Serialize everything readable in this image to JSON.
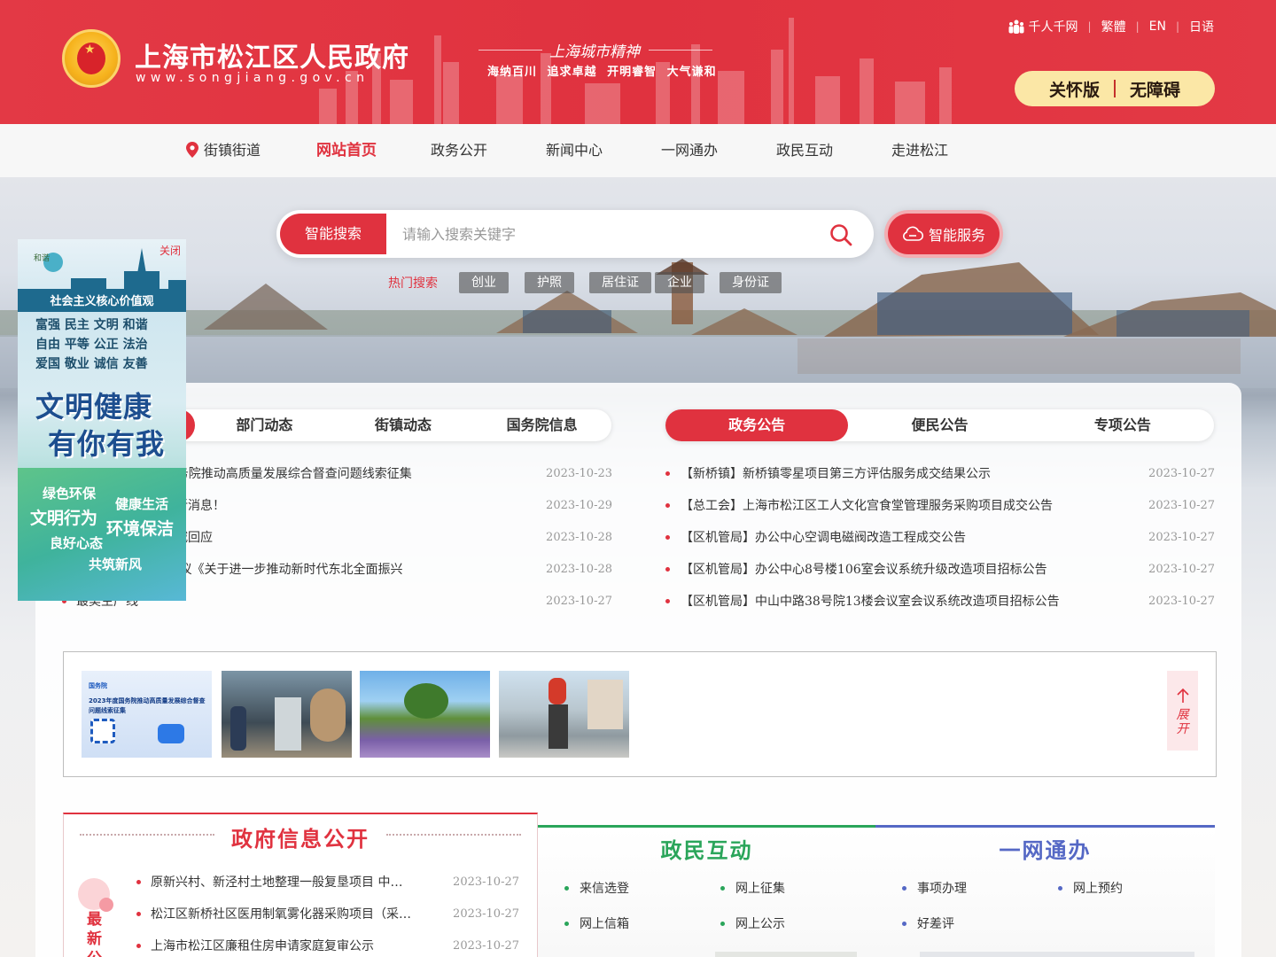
{
  "header": {
    "site_title": "上海市松江区人民政府",
    "site_url": "www.songjiang.gov.cn",
    "spirit_title": "上海城市精神",
    "spirit_words": [
      "海纳百川",
      "追求卓越",
      "开明睿智",
      "大气谦和"
    ],
    "top_links": [
      "千人千网",
      "繁體",
      "EN",
      "日语"
    ],
    "care_label": "关怀版",
    "accessible_label": "无障碍",
    "brand_color": "#e0323f"
  },
  "nav": {
    "location_label": "街镇街道",
    "items": [
      "网站首页",
      "政务公开",
      "新闻中心",
      "一网通办",
      "政民互动",
      "走进松江"
    ],
    "active": "网站首页"
  },
  "search": {
    "tag_label": "智能搜索",
    "placeholder": "请输入搜索关键字",
    "smart_service_label": "智能服务",
    "hot_label": "热门搜索",
    "hot_tags": [
      "创业",
      "护照",
      "居住证",
      "企业",
      "身份证"
    ]
  },
  "left_news": {
    "tabs": [
      "部门动态",
      "街镇动态",
      "国务院信息"
    ],
    "items": [
      {
        "title": "”平台2023年度国务院推动高质量发展综合督查问题线索征集",
        "date": "2023-10-23"
      },
      {
        "title": "刚刚多部门发布最新消息！",
        "date": "2023-10-29"
      },
      {
        "title": "年人网络保护，权威回应",
        "date": "2023-10-28"
      },
      {
        "title": "中央政治局会议 审议《关于进一步推动新时代东北全面振兴",
        "date": "2023-10-28"
      },
      {
        "title": "最美生产线",
        "date": "2023-10-27"
      }
    ]
  },
  "right_news": {
    "tabs": [
      "政务公告",
      "便民公告",
      "专项公告"
    ],
    "active": "政务公告",
    "items": [
      {
        "title": "【新桥镇】新桥镇零星项目第三方评估服务成交结果公示",
        "date": "2023-10-27"
      },
      {
        "title": "【总工会】上海市松江区工人文化宫食堂管理服务采购项目成交公告",
        "date": "2023-10-27"
      },
      {
        "title": "【区机管局】办公中心空调电磁阀改造工程成交公告",
        "date": "2023-10-27"
      },
      {
        "title": "【区机管局】办公中心8号楼106室会议系统升级改造项目招标公告",
        "date": "2023-10-27"
      },
      {
        "title": "【区机管局】中山中路38号院13楼会议室会议系统改造项目招标公告",
        "date": "2023-10-27"
      }
    ]
  },
  "thumbs": {
    "expand_label": "展开",
    "thumb1_lines": [
      "国务院",
      "2023年度国务院推动高质量发展综合督查",
      "问题线索征集"
    ]
  },
  "gov_info": {
    "title": "政府信息公开",
    "side_label": "最新公",
    "items": [
      {
        "title": "原新兴村、新泾村土地整理一般复垦项目 中标公告",
        "date": "2023-10-27"
      },
      {
        "title": "松江区新桥社区医用制氧雾化器采购项目（采购结果公告）",
        "date": "2023-10-27"
      },
      {
        "title": "上海市松江区廉租住房申请家庭复审公示",
        "date": "2023-10-27"
      }
    ]
  },
  "interaction": {
    "title": "政民互动",
    "color": "#2aa55a",
    "items": [
      "来信选登",
      "网上征集",
      "网上信箱",
      "网上公示"
    ]
  },
  "one_net": {
    "title": "一网通办",
    "color": "#5568c5",
    "items": [
      "事项办理",
      "网上预约",
      "好差评"
    ]
  },
  "float_ad": {
    "close_label": "关闭",
    "heading": "社会主义核心价值观",
    "values": [
      "富强 民主 文明 和谐",
      "自由 平等 公正 法治",
      "爱国 敬业 诚信 友善"
    ],
    "slogan1": "文明健康",
    "slogan2": "有你有我",
    "tags": [
      "绿色环保",
      "健康生活",
      "文明行为",
      "环境保洁",
      "良好心态",
      "共筑新风"
    ]
  }
}
